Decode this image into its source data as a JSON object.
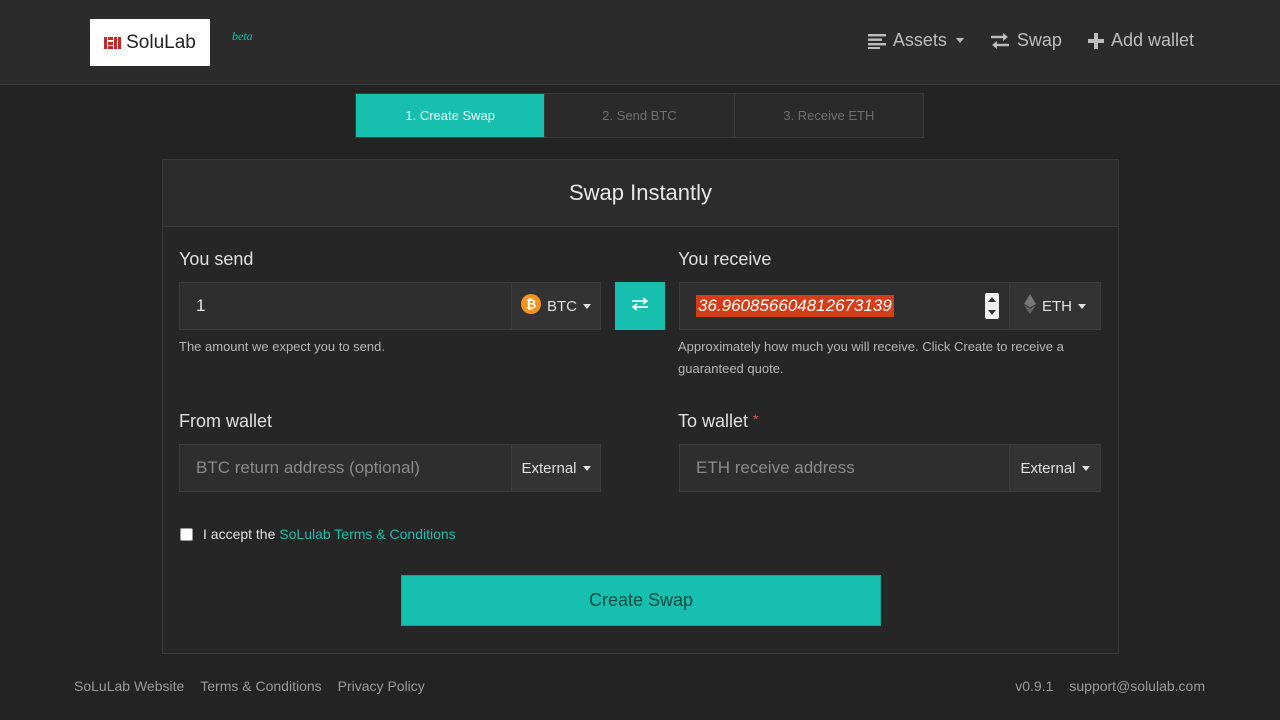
{
  "header": {
    "logo_text": "SoluLab",
    "beta": "beta",
    "nav": {
      "assets": "Assets",
      "swap": "Swap",
      "add_wallet": "Add wallet"
    }
  },
  "steps": [
    "1. Create Swap",
    "2. Send BTC",
    "3. Receive ETH"
  ],
  "card": {
    "title": "Swap Instantly",
    "send": {
      "label": "You send",
      "value": "1",
      "currency": "BTC",
      "help": "The amount we expect you to send."
    },
    "receive": {
      "label": "You receive",
      "value": "36.960856604812673139",
      "currency": "ETH",
      "help": "Approximately how much you will receive. Click Create to receive a guaranteed quote."
    },
    "from_wallet": {
      "label": "From wallet",
      "placeholder": "BTC return address (optional)",
      "type": "External"
    },
    "to_wallet": {
      "label": "To wallet",
      "required_mark": "*",
      "placeholder": "ETH receive address",
      "type": "External"
    },
    "terms": {
      "prefix": "I accept the",
      "link": "SoLulab Terms & Conditions"
    },
    "create_button": "Create Swap"
  },
  "footer": {
    "website": "SoLuLab Website",
    "terms": "Terms & Conditions",
    "privacy": "Privacy Policy",
    "version": "v0.9.1",
    "support": "support@solulab.com"
  },
  "colors": {
    "accent": "#17bfae",
    "background": "#232323",
    "highlight": "#d43d1a",
    "btc": "#f7931a"
  }
}
